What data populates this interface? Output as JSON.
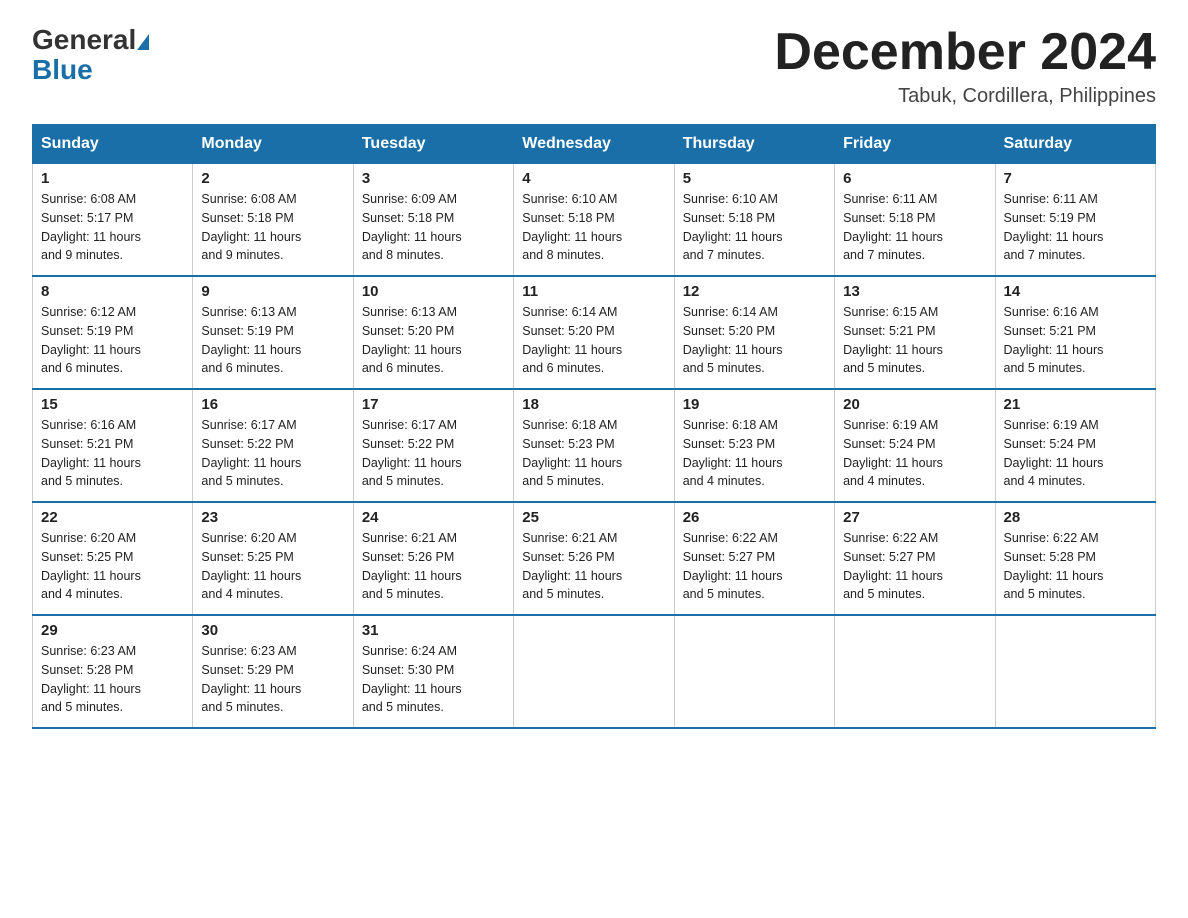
{
  "logo": {
    "general": "General",
    "blue": "Blue"
  },
  "title": "December 2024",
  "subtitle": "Tabuk, Cordillera, Philippines",
  "days": [
    "Sunday",
    "Monday",
    "Tuesday",
    "Wednesday",
    "Thursday",
    "Friday",
    "Saturday"
  ],
  "weeks": [
    [
      {
        "day": "1",
        "sunrise": "6:08 AM",
        "sunset": "5:17 PM",
        "daylight": "11 hours and 9 minutes."
      },
      {
        "day": "2",
        "sunrise": "6:08 AM",
        "sunset": "5:18 PM",
        "daylight": "11 hours and 9 minutes."
      },
      {
        "day": "3",
        "sunrise": "6:09 AM",
        "sunset": "5:18 PM",
        "daylight": "11 hours and 8 minutes."
      },
      {
        "day": "4",
        "sunrise": "6:10 AM",
        "sunset": "5:18 PM",
        "daylight": "11 hours and 8 minutes."
      },
      {
        "day": "5",
        "sunrise": "6:10 AM",
        "sunset": "5:18 PM",
        "daylight": "11 hours and 7 minutes."
      },
      {
        "day": "6",
        "sunrise": "6:11 AM",
        "sunset": "5:18 PM",
        "daylight": "11 hours and 7 minutes."
      },
      {
        "day": "7",
        "sunrise": "6:11 AM",
        "sunset": "5:19 PM",
        "daylight": "11 hours and 7 minutes."
      }
    ],
    [
      {
        "day": "8",
        "sunrise": "6:12 AM",
        "sunset": "5:19 PM",
        "daylight": "11 hours and 6 minutes."
      },
      {
        "day": "9",
        "sunrise": "6:13 AM",
        "sunset": "5:19 PM",
        "daylight": "11 hours and 6 minutes."
      },
      {
        "day": "10",
        "sunrise": "6:13 AM",
        "sunset": "5:20 PM",
        "daylight": "11 hours and 6 minutes."
      },
      {
        "day": "11",
        "sunrise": "6:14 AM",
        "sunset": "5:20 PM",
        "daylight": "11 hours and 6 minutes."
      },
      {
        "day": "12",
        "sunrise": "6:14 AM",
        "sunset": "5:20 PM",
        "daylight": "11 hours and 5 minutes."
      },
      {
        "day": "13",
        "sunrise": "6:15 AM",
        "sunset": "5:21 PM",
        "daylight": "11 hours and 5 minutes."
      },
      {
        "day": "14",
        "sunrise": "6:16 AM",
        "sunset": "5:21 PM",
        "daylight": "11 hours and 5 minutes."
      }
    ],
    [
      {
        "day": "15",
        "sunrise": "6:16 AM",
        "sunset": "5:21 PM",
        "daylight": "11 hours and 5 minutes."
      },
      {
        "day": "16",
        "sunrise": "6:17 AM",
        "sunset": "5:22 PM",
        "daylight": "11 hours and 5 minutes."
      },
      {
        "day": "17",
        "sunrise": "6:17 AM",
        "sunset": "5:22 PM",
        "daylight": "11 hours and 5 minutes."
      },
      {
        "day": "18",
        "sunrise": "6:18 AM",
        "sunset": "5:23 PM",
        "daylight": "11 hours and 5 minutes."
      },
      {
        "day": "19",
        "sunrise": "6:18 AM",
        "sunset": "5:23 PM",
        "daylight": "11 hours and 4 minutes."
      },
      {
        "day": "20",
        "sunrise": "6:19 AM",
        "sunset": "5:24 PM",
        "daylight": "11 hours and 4 minutes."
      },
      {
        "day": "21",
        "sunrise": "6:19 AM",
        "sunset": "5:24 PM",
        "daylight": "11 hours and 4 minutes."
      }
    ],
    [
      {
        "day": "22",
        "sunrise": "6:20 AM",
        "sunset": "5:25 PM",
        "daylight": "11 hours and 4 minutes."
      },
      {
        "day": "23",
        "sunrise": "6:20 AM",
        "sunset": "5:25 PM",
        "daylight": "11 hours and 4 minutes."
      },
      {
        "day": "24",
        "sunrise": "6:21 AM",
        "sunset": "5:26 PM",
        "daylight": "11 hours and 5 minutes."
      },
      {
        "day": "25",
        "sunrise": "6:21 AM",
        "sunset": "5:26 PM",
        "daylight": "11 hours and 5 minutes."
      },
      {
        "day": "26",
        "sunrise": "6:22 AM",
        "sunset": "5:27 PM",
        "daylight": "11 hours and 5 minutes."
      },
      {
        "day": "27",
        "sunrise": "6:22 AM",
        "sunset": "5:27 PM",
        "daylight": "11 hours and 5 minutes."
      },
      {
        "day": "28",
        "sunrise": "6:22 AM",
        "sunset": "5:28 PM",
        "daylight": "11 hours and 5 minutes."
      }
    ],
    [
      {
        "day": "29",
        "sunrise": "6:23 AM",
        "sunset": "5:28 PM",
        "daylight": "11 hours and 5 minutes."
      },
      {
        "day": "30",
        "sunrise": "6:23 AM",
        "sunset": "5:29 PM",
        "daylight": "11 hours and 5 minutes."
      },
      {
        "day": "31",
        "sunrise": "6:24 AM",
        "sunset": "5:30 PM",
        "daylight": "11 hours and 5 minutes."
      },
      null,
      null,
      null,
      null
    ]
  ]
}
